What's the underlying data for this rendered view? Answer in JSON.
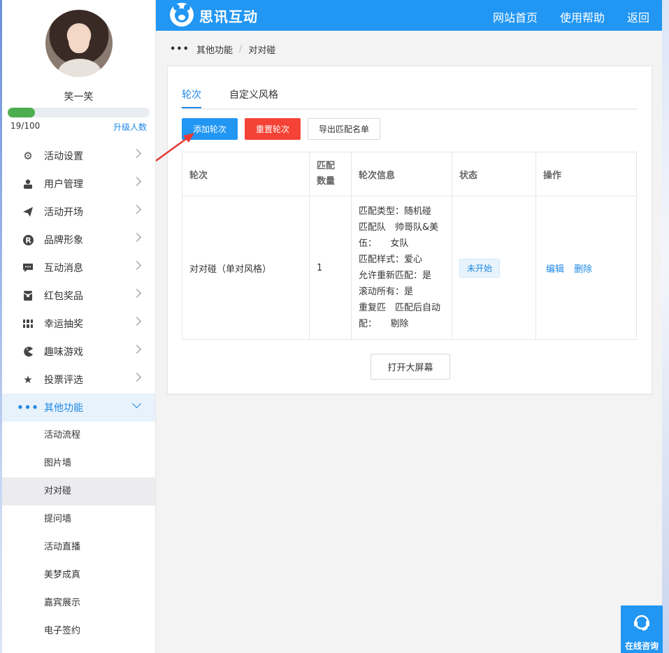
{
  "colors": {
    "primary": "#2196f3",
    "danger": "#f44336",
    "success": "#4cae4f"
  },
  "user": {
    "name": "笑一笑",
    "progress_text": "19/100",
    "progress_fraction": 0.19,
    "upgrade_label": "升级人数"
  },
  "sidebar": {
    "menu": [
      {
        "label": "活动设置",
        "icon": "gears-icon"
      },
      {
        "label": "用户管理",
        "icon": "user-card-icon"
      },
      {
        "label": "活动开场",
        "icon": "paper-plane-icon"
      },
      {
        "label": "品牌形象",
        "icon": "registered-icon"
      },
      {
        "label": "互动消息",
        "icon": "chat-icon"
      },
      {
        "label": "红包奖品",
        "icon": "red-envelope-icon"
      },
      {
        "label": "幸运抽奖",
        "icon": "lottery-icon"
      },
      {
        "label": "趣味游戏",
        "icon": "pacman-icon"
      },
      {
        "label": "投票评选",
        "icon": "star-icon"
      },
      {
        "label": "其他功能",
        "icon": "more-dots-icon"
      }
    ],
    "submenu": [
      "活动流程",
      "图片墙",
      "对对碰",
      "提问墙",
      "活动直播",
      "美梦成真",
      "嘉宾展示",
      "电子签约"
    ],
    "selected_sub": "对对碰"
  },
  "topbar": {
    "logo_text": "思讯互动",
    "nav": [
      "网站首页",
      "使用帮助",
      "返回"
    ]
  },
  "breadcrumb": {
    "parent": "其他功能",
    "current": "对对碰"
  },
  "tabs": [
    "轮次",
    "自定义风格"
  ],
  "buttons": {
    "add": "添加轮次",
    "reset": "重置轮次",
    "export": "导出匹配名单",
    "open_screen": "打开大屏幕"
  },
  "table": {
    "headers": [
      "轮次",
      "匹配数量",
      "轮次信息",
      "状态",
      "操作"
    ],
    "rows": [
      {
        "round": "对对碰（单对风格）",
        "count": "1",
        "info": [
          "匹配类型：随机碰",
          "匹配队　帅哥队&美",
          "伍：　　女队",
          "匹配样式：爱心",
          "允许重新匹配：是",
          "滚动所有：是",
          "重复匹　匹配后自动",
          "配：　　剔除"
        ],
        "status": "未开始",
        "ops": [
          "编辑",
          "删除"
        ]
      }
    ]
  },
  "consult": {
    "label": "在线咨询"
  }
}
